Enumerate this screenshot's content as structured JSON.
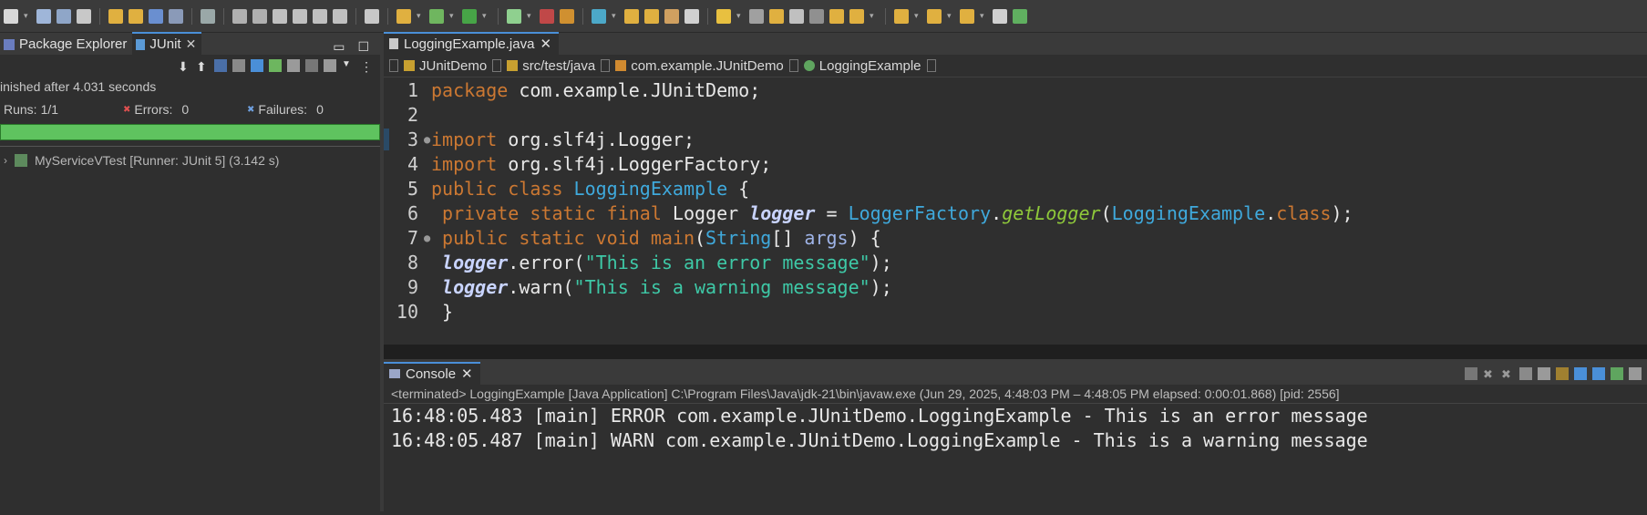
{
  "toolbar": {
    "icons": [
      "new-icon",
      "save-icon",
      "save-all-icon",
      "build-icon",
      "undo-icon",
      "redo-icon",
      "view-icon",
      "search-icon",
      "resume-icon",
      "suspend-icon",
      "terminate-icon",
      "step-into-icon",
      "step-over-icon",
      "step-return-icon",
      "drop-frame-icon",
      "list-icon",
      "quick-fix-icon",
      "debug-icon",
      "run-icon",
      "run-external-icon",
      "coverage-icon",
      "open-type-icon",
      "refresh-icon",
      "open-folder-icon",
      "open-file-icon",
      "brush-icon",
      "pin-icon",
      "pencil-icon",
      "link-icon",
      "toggle-icon",
      "block-icon",
      "pilcrow-icon",
      "annotation-icon",
      "next-annotation-icon",
      "back-icon",
      "forward-icon",
      "history-back-icon",
      "history-forward-icon",
      "perspective-icon"
    ]
  },
  "left": {
    "tabs": [
      {
        "label": "Package Explorer"
      },
      {
        "label": "JUnit"
      }
    ],
    "status": "inished after 4.031 seconds",
    "runs_label": "Runs:",
    "runs_value": "1/1",
    "errors_label": "Errors:",
    "errors_value": "0",
    "failures_label": "Failures:",
    "failures_value": "0",
    "progress": 1.0,
    "tree_item": "MyServiceVTest [Runner: JUnit 5] (3.142 s)"
  },
  "editor": {
    "tab": "LoggingExample.java",
    "crumbs": [
      "JUnitDemo",
      "src/test/java",
      "com.example.JUnitDemo",
      "LoggingExample"
    ],
    "line_numbers": [
      "1",
      "2",
      "3",
      "4",
      "5",
      "6",
      "7",
      "8",
      "9",
      "10"
    ],
    "code": {
      "l1_kw": "package",
      "l1_rest": " com.example.JUnitDemo;",
      "l3_kw": "import",
      "l3_rest": " org.slf4j.Logger;",
      "l4_kw": "import",
      "l4_rest": " org.slf4j.LoggerFactory;",
      "l5_kw": "public class ",
      "l5_type": "LoggingExample",
      "l5_rest": " {",
      "l6_kw": "private static final ",
      "l6_type": "Logger",
      "l6_field": "logger",
      "l6_eq": " = ",
      "l6_cls": "LoggerFactory",
      "l6_dot": ".",
      "l6_fn": "getLogger",
      "l6_p": "(",
      "l6_cls2": "LoggingExample",
      "l6_dot2": ".",
      "l6_kw2": "class",
      "l6_end": ");",
      "l7_kw": "public static void ",
      "l7_fn": "main",
      "l7_p": "(",
      "l7_type": "String",
      "l7_br": "[] ",
      "l7_var": "args",
      "l7_end": ") {",
      "l8_field": "logger",
      "l8_call": ".error(",
      "l8_str": "\"This is an error message\"",
      "l8_end": ");",
      "l9_field": "logger",
      "l9_call": ".warn(",
      "l9_str": "\"This is a warning message\"",
      "l9_end": ");",
      "l10": "}"
    }
  },
  "console": {
    "tab": "Console",
    "terminated": "<terminated> LoggingExample [Java Application] C:\\Program Files\\Java\\jdk-21\\bin\\javaw.exe  (Jun 29, 2025, 4:48:03 PM – 4:48:05 PM elapsed: 0:00:01.868) [pid: 2556]",
    "lines": [
      "16:48:05.483 [main] ERROR com.example.JUnitDemo.LoggingExample - This is an error message",
      "16:48:05.487 [main] WARN com.example.JUnitDemo.LoggingExample - This is a warning message"
    ]
  },
  "colors": {
    "progress": "#5fc35f",
    "keyword": "#cc7832",
    "type": "#3fa9dc",
    "string": "#3ec9a7",
    "accent": "#4a8fd8"
  }
}
